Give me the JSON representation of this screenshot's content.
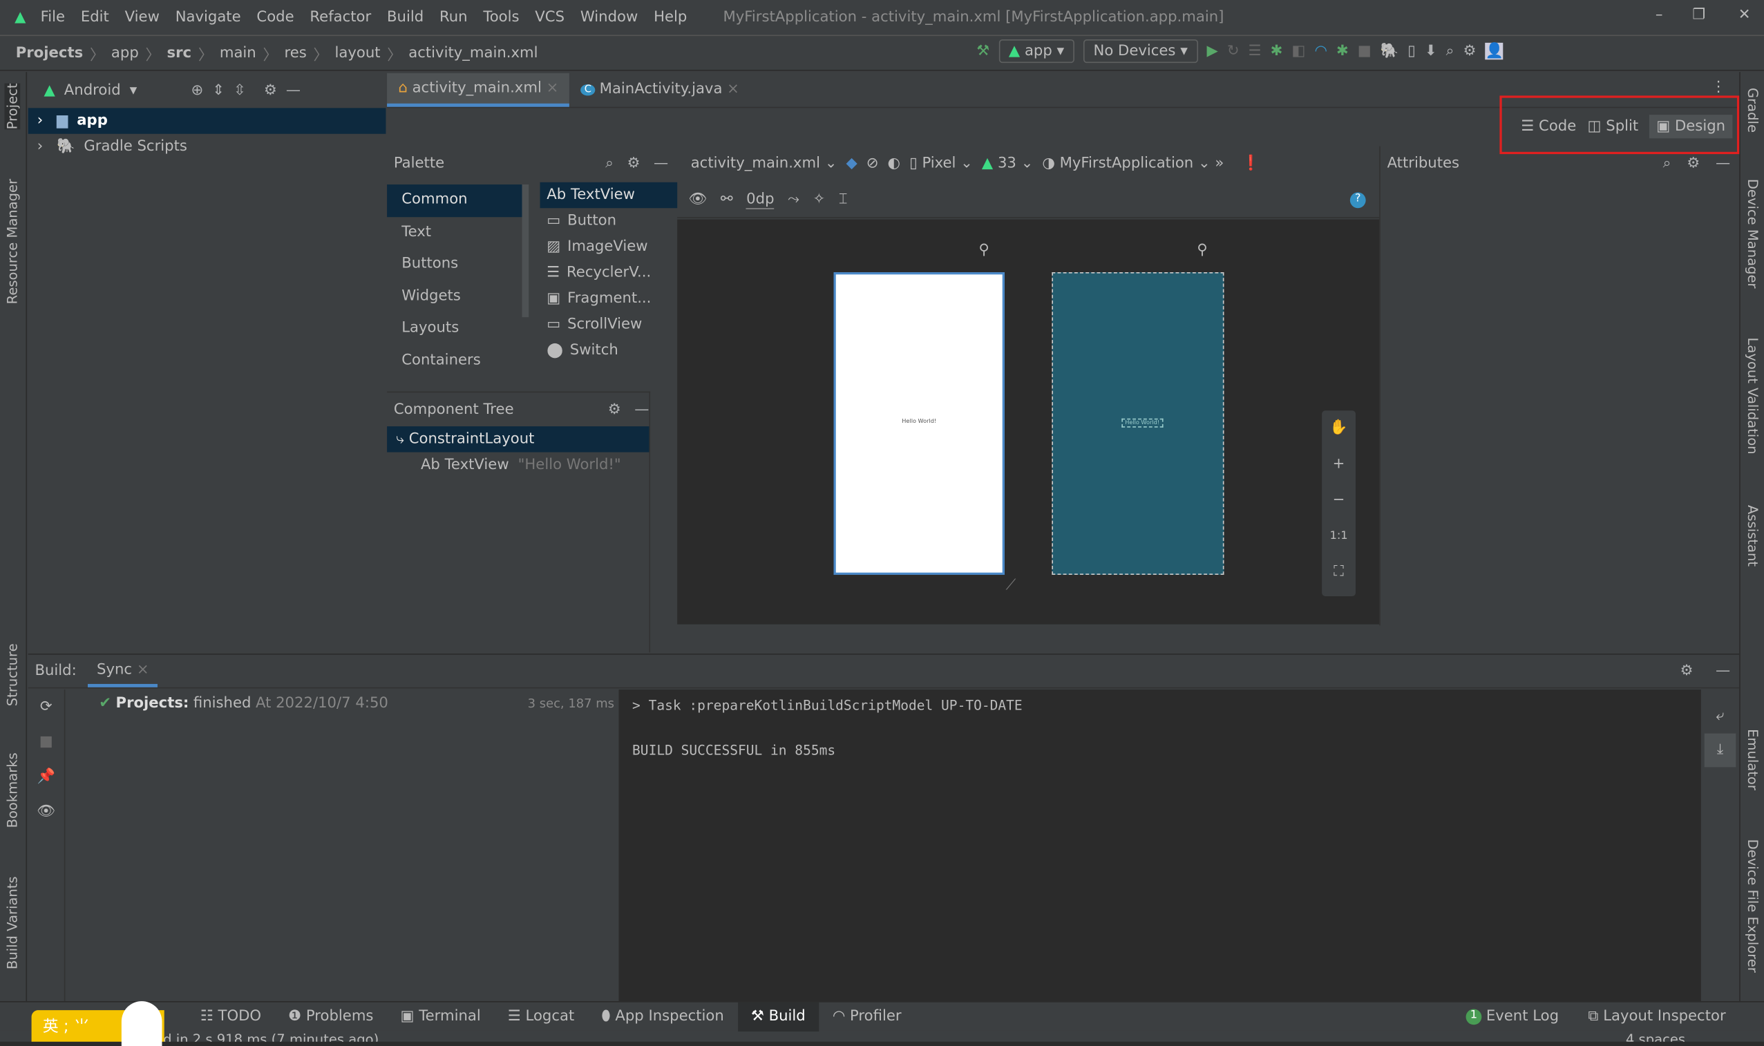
{
  "menu": [
    "File",
    "Edit",
    "View",
    "Navigate",
    "Code",
    "Refactor",
    "Build",
    "Run",
    "Tools",
    "VCS",
    "Window",
    "Help"
  ],
  "window_title": "MyFirstApplication - activity_main.xml [MyFirstApplication.app.main]",
  "breadcrumb": [
    "Projects",
    "app",
    "src",
    "main",
    "res",
    "layout",
    "activity_main.xml"
  ],
  "toolbar": {
    "run_config": "app",
    "device": "No Devices"
  },
  "project": {
    "view": "Android",
    "items": [
      "app",
      "Gradle Scripts"
    ]
  },
  "tabs": [
    {
      "label": "activity_main.xml",
      "active": true
    },
    {
      "label": "MainActivity.java",
      "active": false
    }
  ],
  "view_modes": {
    "code": "Code",
    "split": "Split",
    "design": "Design",
    "selected": "Design"
  },
  "palette": {
    "title": "Palette",
    "categories": [
      "Common",
      "Text",
      "Buttons",
      "Widgets",
      "Layouts",
      "Containers"
    ],
    "items": [
      "Ab TextView",
      "Button",
      "ImageView",
      "RecyclerV...",
      "Fragment...",
      "ScrollView",
      "Switch"
    ]
  },
  "design_toolbar": {
    "file": "activity_main.xml",
    "device": "Pixel",
    "api": "33",
    "theme": "MyFirstApplication",
    "margin": "0dp"
  },
  "component_tree": {
    "title": "Component Tree",
    "root": "ConstraintLayout",
    "child": "Ab TextView",
    "child_text": "\"Hello World!\""
  },
  "preview": {
    "text": "Hello World!",
    "zoom_reset": "1:1"
  },
  "attributes": {
    "title": "Attributes"
  },
  "build": {
    "label": "Build:",
    "tab": "Sync",
    "status": "Projects:",
    "status_detail": "finished",
    "time": "At 2022/10/7 4:50",
    "duration": "3 sec, 187 ms",
    "output": [
      "> Task :prepareKotlinBuildScriptModel UP-TO-DATE",
      "",
      "BUILD SUCCESSFUL in 855ms"
    ]
  },
  "bottom_tabs": [
    "TODO",
    "Problems",
    "Terminal",
    "Logcat",
    "App Inspection",
    "Build",
    "Profiler"
  ],
  "bottom_right": {
    "event_log": "Event Log",
    "event_count": "1",
    "layout_inspector": "Layout Inspector"
  },
  "statusbar": {
    "message": "d in 2 s 918 ms (7 minutes ago)",
    "indent": "4 spaces"
  },
  "ime": "英 ; ⺌",
  "left_strip": [
    "Project",
    "Resource Manager",
    "Structure",
    "Bookmarks",
    "Build Variants"
  ],
  "right_strip": [
    "Gradle",
    "Device Manager",
    "Layout Validation",
    "Assistant",
    "Emulator",
    "Device File Explorer"
  ],
  "colors": {
    "accent": "#4a88c7",
    "android_green": "#3ddc84",
    "blueprint": "#235c6e",
    "highlight": "#e02020"
  }
}
